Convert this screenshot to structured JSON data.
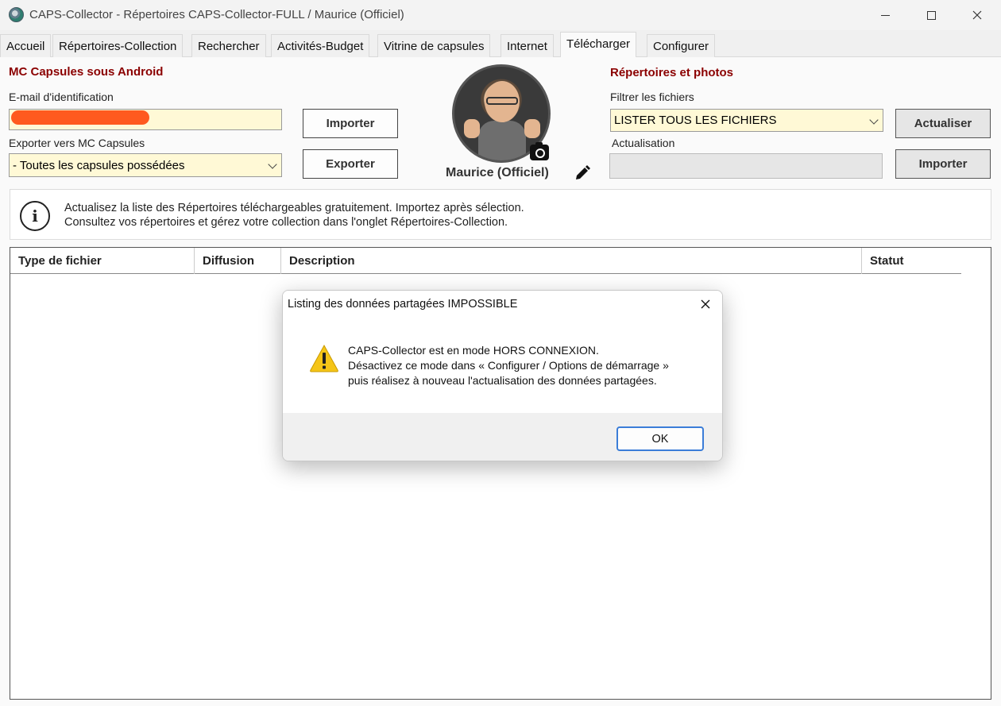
{
  "window": {
    "title": "CAPS-Collector - Répertoires CAPS-Collector-FULL / Maurice (Officiel)"
  },
  "tabs": [
    {
      "label": "Accueil"
    },
    {
      "label": "Répertoires-Collection"
    },
    {
      "label": "Rechercher"
    },
    {
      "label": "Activités-Budget"
    },
    {
      "label": "Vitrine de capsules"
    },
    {
      "label": "Internet"
    },
    {
      "label": "Télécharger"
    },
    {
      "label": "Configurer"
    }
  ],
  "active_tab": "Télécharger",
  "android": {
    "section_title": "MC Capsules sous Android",
    "email_label": "E-mail d'identification",
    "email_value": "",
    "import_button": "Importer",
    "export_label": "Exporter vers MC Capsules",
    "export_selected": "- Toutes les capsules possédées",
    "export_button": "Exporter"
  },
  "profile": {
    "name": "Maurice (Officiel)"
  },
  "directories": {
    "section_title": "Répertoires et photos",
    "filter_label": "Filtrer les fichiers",
    "filter_selected": "LISTER TOUS LES FICHIERS",
    "refresh_button": "Actualiser",
    "update_label": "Actualisation",
    "update_value": "",
    "import_button": "Importer"
  },
  "info": {
    "line1": "Actualisez la liste des Répertoires téléchargeables gratuitement. Importez après sélection.",
    "line2": "Consultez vos répertoires et gérez votre collection dans l'onglet Répertoires-Collection."
  },
  "grid": {
    "columns": [
      "Type de fichier",
      "Diffusion",
      "Description",
      "Statut"
    ],
    "rows": []
  },
  "dialog": {
    "title": "Listing des données partagées IMPOSSIBLE",
    "line1": "CAPS-Collector est en mode HORS CONNEXION.",
    "line2": "Désactivez ce mode dans « Configurer / Options de démarrage »",
    "line3": "puis réalisez à nouveau l'actualisation des données partagées.",
    "ok_button": "OK"
  },
  "colors": {
    "section_title": "#8b0000",
    "input_background": "#fff9d6",
    "warning": "#f5c518",
    "ok_border": "#3b7dd8",
    "redaction": "#ff5a1f"
  }
}
